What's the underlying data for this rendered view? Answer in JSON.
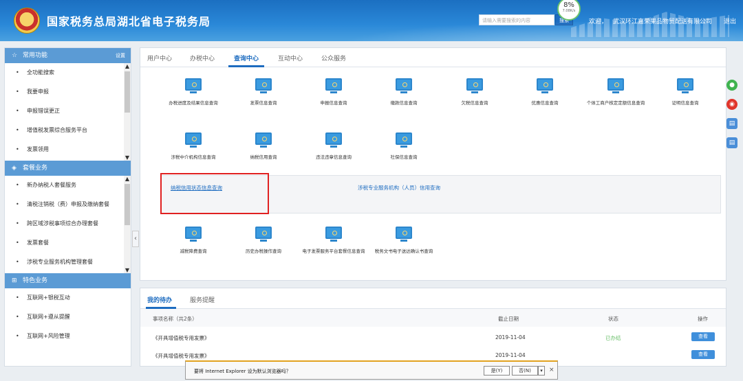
{
  "header": {
    "title": "国家税务总局湖北省电子税务局",
    "search_placeholder": "请输入需要搜索的内容",
    "search_button": "搜索",
    "speed_percent": "8%",
    "speed_rate": "7.08K/s",
    "welcome": "欢迎，",
    "company": "武汉环江嘉荣果品物贸配送有限公司",
    "separator": "|",
    "logout": "退出"
  },
  "sidebar": {
    "common": {
      "title": "常用功能",
      "settings": "设置",
      "items": [
        "全功能搜索",
        "我要申报",
        "申报错误更正",
        "增值税发票综合服务平台",
        "发票领用"
      ]
    },
    "packages": {
      "title": "套餐业务",
      "items": [
        "新办纳税人套餐服务",
        "清税注销税（费）申报及缴纳套餐",
        "跨区域涉税事项综合办理套餐",
        "发票套餐",
        "涉税专业服务机构管理套餐"
      ]
    },
    "special": {
      "title": "特色业务",
      "items": [
        "互联网+银税互动",
        "互联网+遵从提醒",
        "互联网+风险管理"
      ]
    },
    "collapse": "‹"
  },
  "main": {
    "tabs": [
      "用户中心",
      "办税中心",
      "查询中心",
      "互动中心",
      "公众服务"
    ],
    "active_tab": 2,
    "row1": [
      "办税进度及结果信息查询",
      "发票信息查询",
      "申报信息查询",
      "缴款信息查询",
      "欠税信息查询",
      "优惠信息查询",
      "个体工商户核定定额信息查询",
      "证明信息查询"
    ],
    "row2": [
      "涉税中介机构信息查询",
      "纳税信用查询",
      "违法违章信息查询",
      "社保信息查询"
    ],
    "credit_links": [
      "纳税信用状态信息查询",
      "涉税专业服务机构（人员）信用查询"
    ],
    "row3": [
      "减税降费查询",
      "历史办税操作查询",
      "电子发票服务平台套餐信息查询",
      "税务文书电子送达确认书查询"
    ]
  },
  "tasks": {
    "tabs": [
      "我的待办",
      "服务提醒"
    ],
    "headers": [
      "事项名称（共2条）",
      "截止日期",
      "状态",
      "操作"
    ],
    "rows": [
      {
        "name": "《开具增值税专用发票》",
        "date": "2019-11-04",
        "status": "已办结",
        "action": "查看"
      },
      {
        "name": "《开具增值税专用发票》",
        "date": "2019-11-04",
        "status": "",
        "action": "查看"
      }
    ]
  },
  "ie_bar": {
    "message": "要将 Internet Explorer 设为默认浏览器吗？",
    "yes": "是(Y)",
    "no": "否(N)",
    "dropdown": "▾",
    "close": "×"
  },
  "float_icons": [
    "wechat-icon",
    "weibo-icon",
    "printer-icon",
    "printer-icon"
  ],
  "colors": {
    "brand": "#1d6cc0",
    "section": "#5b9bd5",
    "highlight": "#e02020",
    "done": "#6bc06b"
  }
}
